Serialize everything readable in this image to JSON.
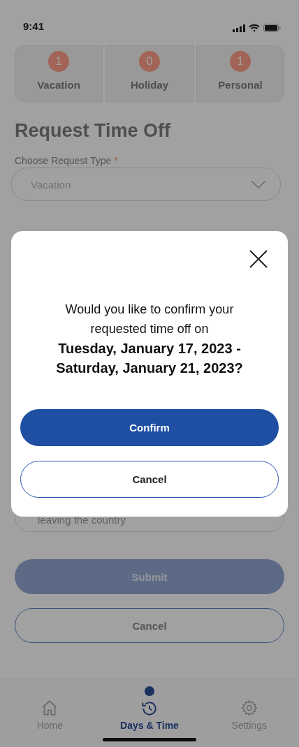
{
  "status_bar": {
    "time": "9:41"
  },
  "summary": [
    {
      "count": "1",
      "label": "Vacation"
    },
    {
      "count": "0",
      "label": "Holiday"
    },
    {
      "count": "1",
      "label": "Personal"
    }
  ],
  "title": "Request Time Off",
  "request_type": {
    "label": "Choose Request Type",
    "required_mark": "*",
    "value": "Vacation"
  },
  "reason": {
    "value": "leaving the country"
  },
  "submit": {
    "label": "Submit",
    "disabled": true
  },
  "cancel": {
    "label": "Cancel"
  },
  "nav": [
    {
      "kind": "home",
      "label": "Home",
      "selected": false
    },
    {
      "kind": "history",
      "label": "Days & Time",
      "selected": true
    },
    {
      "kind": "settings",
      "label": "Settings",
      "selected": false
    }
  ],
  "modal": {
    "message": "Would you like to confirm your requested time off on",
    "dates": "Tuesday, January 17, 2023 - Saturday, January 21, 2023?",
    "confirm": "Confirm",
    "cancel": "Cancel"
  }
}
